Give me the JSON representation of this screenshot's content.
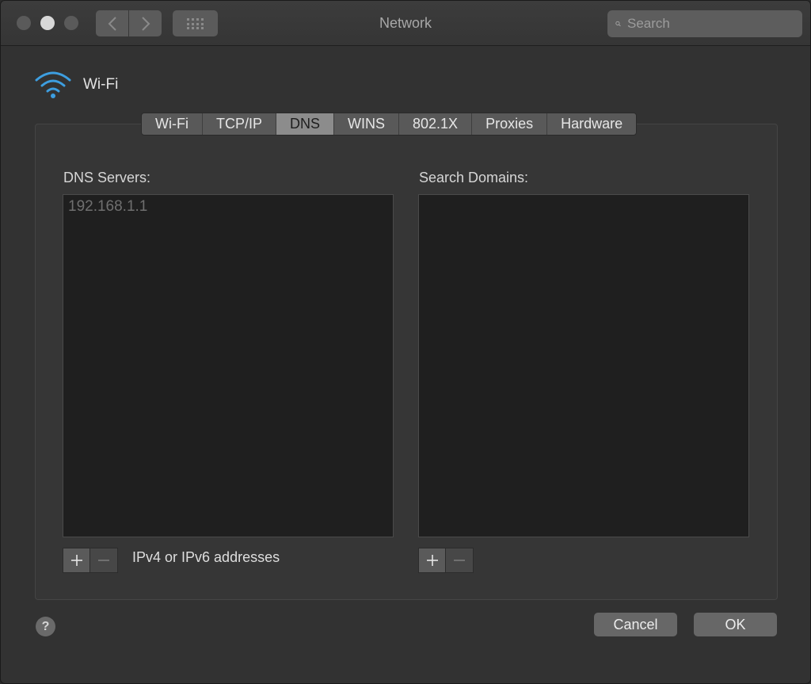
{
  "window": {
    "title": "Network"
  },
  "toolbar": {
    "search_placeholder": "Search"
  },
  "interface": {
    "name": "Wi-Fi"
  },
  "tabs": [
    {
      "label": "Wi-Fi",
      "active": false
    },
    {
      "label": "TCP/IP",
      "active": false
    },
    {
      "label": "DNS",
      "active": true
    },
    {
      "label": "WINS",
      "active": false
    },
    {
      "label": "802.1X",
      "active": false
    },
    {
      "label": "Proxies",
      "active": false
    },
    {
      "label": "Hardware",
      "active": false
    }
  ],
  "dns": {
    "servers_label": "DNS Servers:",
    "servers": [
      "192.168.1.1"
    ],
    "hint": "IPv4 or IPv6 addresses",
    "add_symbol": "+",
    "remove_symbol": "−"
  },
  "search_domains": {
    "label": "Search Domains:",
    "domains": [],
    "add_symbol": "+",
    "remove_symbol": "−"
  },
  "footer": {
    "help_label": "?",
    "cancel_label": "Cancel",
    "ok_label": "OK"
  },
  "colors": {
    "accent_wifi": "#3d9ee0",
    "active_tab": "#8c8c8c"
  }
}
